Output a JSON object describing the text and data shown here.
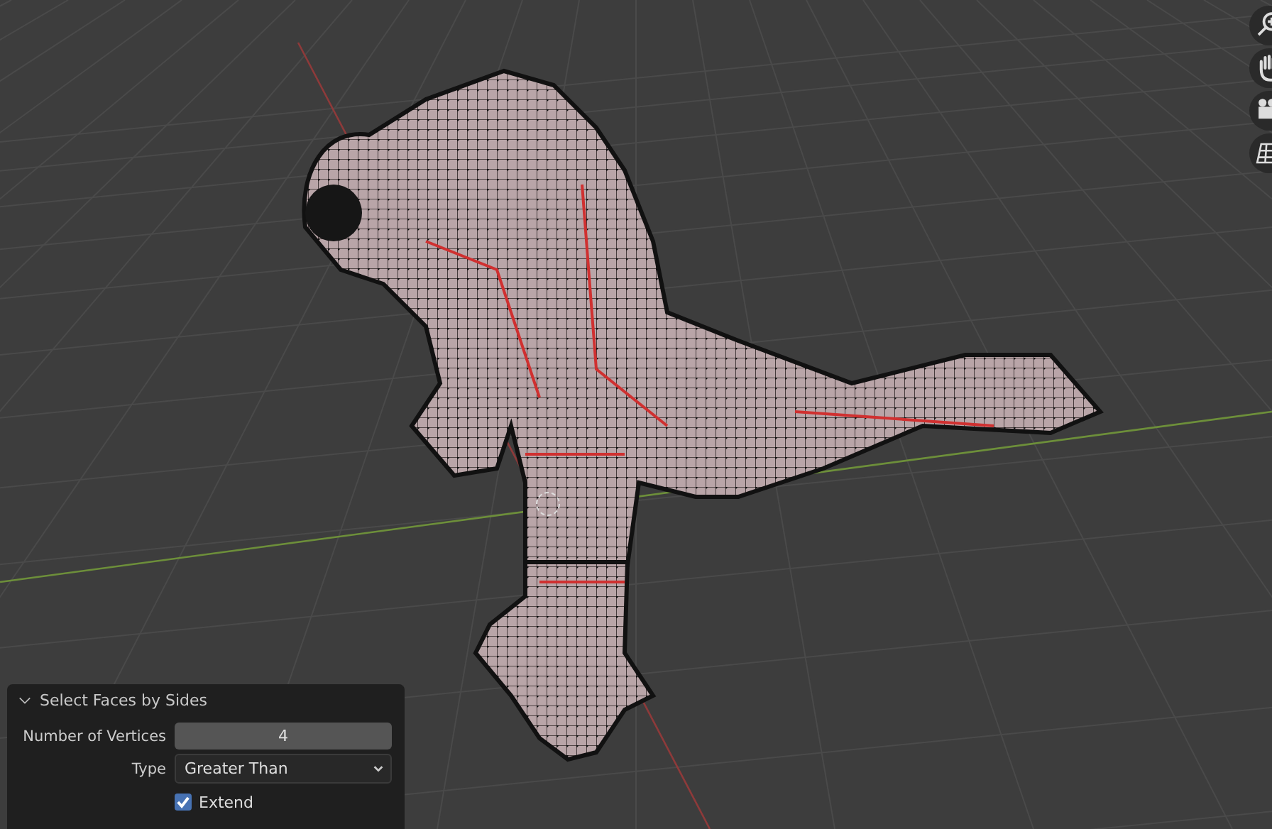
{
  "viewport": {
    "nav_buttons": [
      {
        "kind": "zoom"
      },
      {
        "kind": "pan"
      },
      {
        "kind": "camera"
      },
      {
        "kind": "grid"
      }
    ]
  },
  "operator_panel": {
    "title": "Select Faces by Sides",
    "expanded": true,
    "fields": [
      {
        "kind": "number",
        "label": "Number of Vertices",
        "value": "4"
      },
      {
        "kind": "dropdown",
        "label": "Type",
        "value": "Greater Than"
      },
      {
        "kind": "checkbox",
        "label": "Extend",
        "checked": true
      }
    ]
  }
}
